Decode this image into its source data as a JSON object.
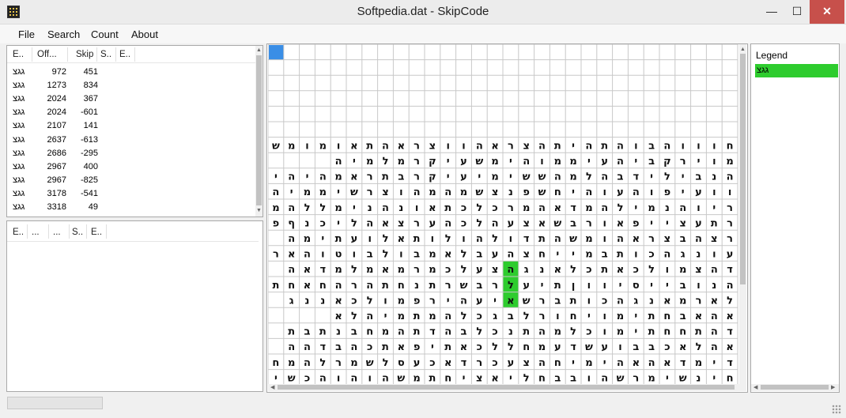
{
  "window": {
    "title": "Softpedia.dat - SkipCode",
    "minimize": "—",
    "maximize": "☐",
    "close": "✕"
  },
  "menu": [
    "File",
    "Search",
    "Count",
    "About"
  ],
  "results": {
    "columns": [
      "E..",
      "Off...",
      "Skip",
      "S..",
      "E.."
    ],
    "rows": [
      [
        "גגצ",
        "972",
        "451"
      ],
      [
        "גגצ",
        "1273",
        "834"
      ],
      [
        "גגצ",
        "2024",
        "367"
      ],
      [
        "גגצ",
        "2024",
        "-601"
      ],
      [
        "גגצ",
        "2107",
        "141"
      ],
      [
        "גגצ",
        "2637",
        "-613"
      ],
      [
        "גגצ",
        "2686",
        "-295"
      ],
      [
        "גגצ",
        "2967",
        "400"
      ],
      [
        "גגצ",
        "2967",
        "-825"
      ],
      [
        "גגצ",
        "3178",
        "-541"
      ],
      [
        "גגצ",
        "3318",
        "49"
      ]
    ]
  },
  "details": {
    "columns": [
      "E..",
      "...",
      "...",
      "S..",
      "E.."
    ]
  },
  "legend": {
    "title": "Legend",
    "items": [
      {
        "label": "גגצ",
        "color": "#2ecc2e"
      }
    ]
  },
  "grid": {
    "selected_color": "#3a8ee6",
    "highlight_color": "#2ecc2e",
    "empty_rows": 6,
    "highlights": [
      [
        8,
        15
      ],
      [
        9,
        15
      ],
      [
        10,
        15
      ]
    ],
    "rows": [
      "חוווהבוהתהיתהצראהווצראהתאומומש",
      "מוירקביהעיממוהימשעיקרמלמיה",
      "הנבילידבהלמהששימיעיקרבתראמהיהי",
      "וועיפוהעוהיחשפנצשמהמהוצרשיממיהל",
      "ריוהנמילהמדאהמרכלכתאונהנימללהמ",
      "רתעצייפאורבשאצעהלכהערצאהליכנףפ",
      "רצהבצרא הומשהתדולהולותאלועתימה",
      "עונגהכותבמייחצהעבלאמבולבוטוהאר",
      "דהצמולכאתכלאנגהצעלכמרמאמלמדאה",
      "הנובייסיווןתיעלרבשרתנחתהרהחאחתו",
      "לארמאנגהכותברשאיעהירפמולכאננג",
      "אהאבחתימויחורלבגכלהמתמיהלא",
      "דהתחחתימוכלמהתנכלבהדתהמחבנתבת",
      "אהלאכבבועשדעמחללכאתיפאתכהבדהה",
      "דימדאהאהימיחהצעכרדאכעסלשמרלהמחנ",
      "חינשימרשהובבחליאציחתמשהוהוהכשי"
    ]
  }
}
